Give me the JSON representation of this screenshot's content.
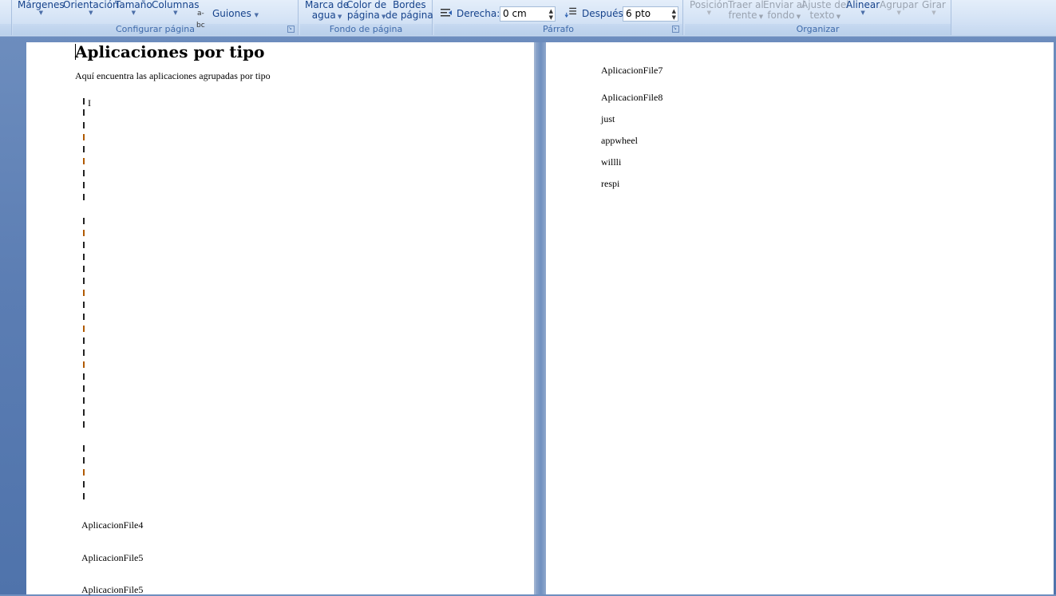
{
  "ribbon": {
    "configurar": {
      "label": "Configurar página",
      "margenes": "Márgenes",
      "orientacion": "Orientación",
      "tamano": "Tamaño",
      "columnas": "Columnas",
      "guiones": "Guiones"
    },
    "fondo": {
      "label": "Fondo de página",
      "marca_1": "Marca de",
      "marca_2": "agua",
      "color_1": "Color de",
      "color_2": "página",
      "bordes_1": "Bordes",
      "bordes_2": "de página"
    },
    "parrafo": {
      "label": "Párrafo",
      "derecha_label": "Derecha:",
      "derecha_value": "0 cm",
      "despues_label": "Después:",
      "despues_value": "6 pto"
    },
    "organizar": {
      "label": "Organizar",
      "posicion": "Posición",
      "traer_1": "Traer al",
      "traer_2": "frente",
      "enviar_1": "Enviar al",
      "enviar_2": "fondo",
      "ajuste_1": "Ajuste del",
      "ajuste_2": "texto",
      "alinear": "Alinear",
      "agrupar": "Agrupar",
      "girar": "Girar"
    }
  },
  "document": {
    "page1": {
      "title": "Aplicaciones por tipo",
      "intro": "Aquí encuentra las aplicaciones agrupadas por tipo",
      "frame_char": "I",
      "items": [
        "AplicacionFile4",
        "AplicacionFile5",
        "AplicacionFile5"
      ]
    },
    "page2": {
      "items": [
        "AplicacionFile7",
        "AplicacionFile8",
        "just",
        "appwheel",
        "willli",
        "respi"
      ]
    }
  }
}
